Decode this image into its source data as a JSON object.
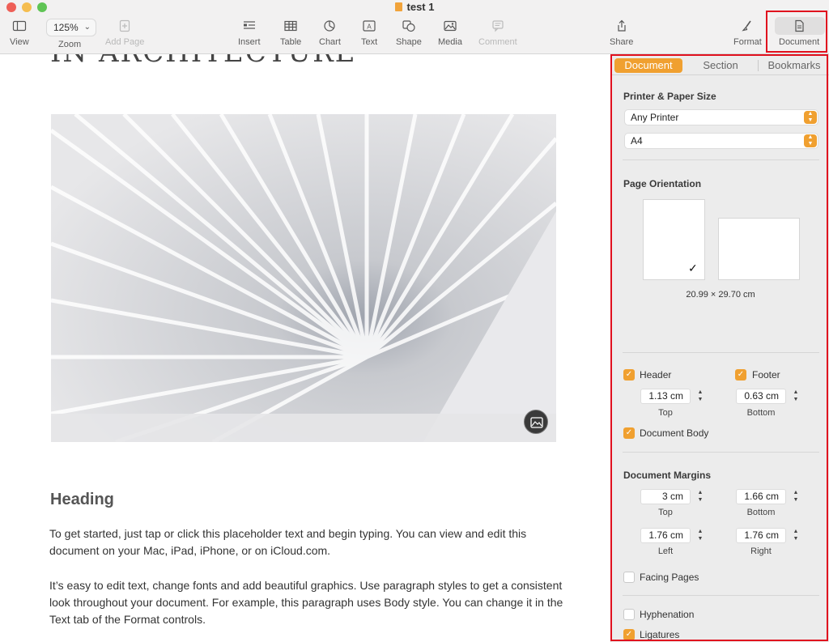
{
  "window": {
    "title": "test 1"
  },
  "toolbar": {
    "view": "View",
    "zoom_value": "125%",
    "zoom": "Zoom",
    "add_page": "Add Page",
    "insert": "Insert",
    "table": "Table",
    "chart": "Chart",
    "text": "Text",
    "shape": "Shape",
    "media": "Media",
    "comment": "Comment",
    "share": "Share",
    "format": "Format",
    "document": "Document"
  },
  "document": {
    "title_cut": "IN ARCHITECTURE",
    "heading": "Heading",
    "paragraph1": "To get started, just tap or click this placeholder text and begin typing. You can view and edit this document on your Mac, iPad, iPhone, or on iCloud.com.",
    "paragraph2": "It’s easy to edit text, change fonts and add beautiful graphics. Use paragraph styles to get a consistent look throughout your document. For example, this paragraph uses Body style. You can change it in the Text tab of the Format controls."
  },
  "inspector": {
    "tabs": [
      "Document",
      "Section",
      "Bookmarks"
    ],
    "printer_section": "Printer & Paper Size",
    "printer": "Any Printer",
    "paper": "A4",
    "orientation_section": "Page Orientation",
    "page_dimensions": "20.99 × 29.70 cm",
    "header_label": "Header",
    "header_checked": true,
    "footer_label": "Footer",
    "footer_checked": true,
    "header_value": "1.13 cm",
    "header_caption": "Top",
    "footer_value": "0.63 cm",
    "footer_caption": "Bottom",
    "document_body_label": "Document Body",
    "document_body_checked": true,
    "margins_section": "Document Margins",
    "margin_top": "3 cm",
    "margin_top_caption": "Top",
    "margin_bottom": "1.66 cm",
    "margin_bottom_caption": "Bottom",
    "margin_left": "1.76 cm",
    "margin_left_caption": "Left",
    "margin_right": "1.76 cm",
    "margin_right_caption": "Right",
    "facing_pages_label": "Facing Pages",
    "facing_pages_checked": false,
    "hyphenation_label": "Hyphenation",
    "hyphenation_checked": false,
    "ligatures_label": "Ligatures",
    "ligatures_checked": true
  },
  "colors": {
    "accent": "#f0a030",
    "highlight": "#e0101e"
  }
}
